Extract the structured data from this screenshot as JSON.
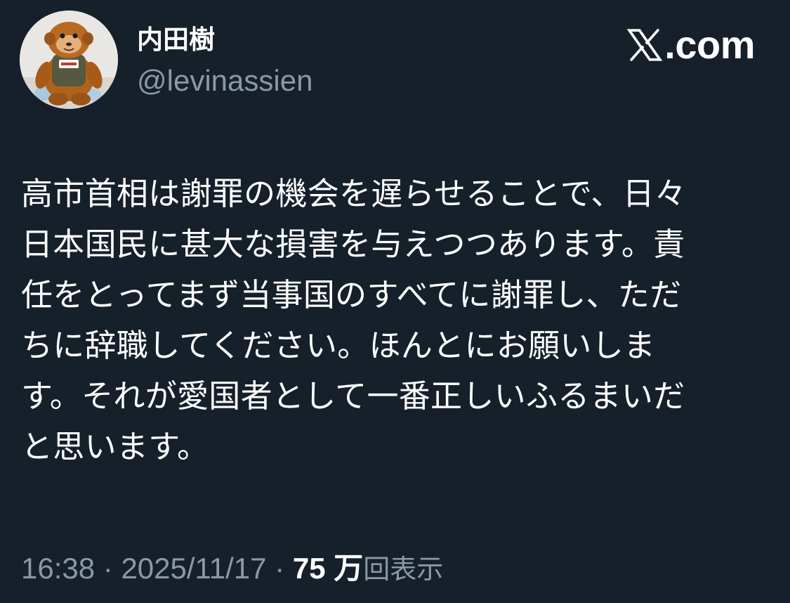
{
  "author": {
    "display_name": "内田樹",
    "handle": "@levinassien",
    "avatar_icon": "orange-monkey-plush-avatar"
  },
  "brand": {
    "logo_icon": "x-logo-icon",
    "text": ".com"
  },
  "tweet": {
    "lines": [
      "高市首相は謝罪の機会を遅らせることで、日々",
      "日本国民に甚大な損害を与えつつあります。責",
      "任をとってまず当事国のすべてに謝罪し、ただ",
      "ちに辞職してください。ほんとにお願いしま",
      "す。それが愛国者として一番正しいふるまいだ",
      "と思います。"
    ]
  },
  "meta": {
    "time": "16:38",
    "separator": " · ",
    "date": "2025/11/17",
    "views_number": "75",
    "views_unit": "万",
    "views_label": "回表示"
  },
  "colors": {
    "background": "#15202b",
    "primary_text": "#ffffff",
    "secondary_text": "#8b98a5"
  }
}
